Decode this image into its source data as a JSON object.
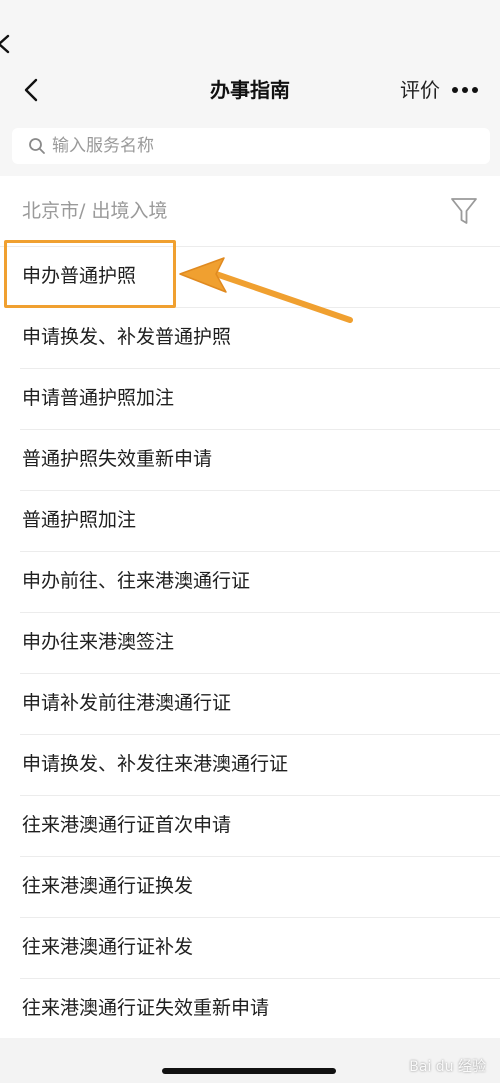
{
  "header": {
    "title": "办事指南",
    "rate_label": "评价"
  },
  "search": {
    "placeholder": "输入服务名称"
  },
  "filter": {
    "breadcrumb": "北京市/ 出境入境"
  },
  "services": [
    "申办普通护照",
    "申请换发、补发普通护照",
    "申请普通护照加注",
    "普通护照失效重新申请",
    "普通护照加注",
    "申办前往、往来港澳通行证",
    "申办往来港澳签注",
    "申请补发前往港澳通行证",
    "申请换发、补发往来港澳通行证",
    "往来港澳通行证首次申请",
    "往来港澳通行证换发",
    "往来港澳通行证补发",
    "往来港澳通行证失效重新申请"
  ],
  "watermark": {
    "text": "Bai du 经验"
  },
  "colors": {
    "highlight": "#f0a030",
    "header_bg": "#f6f6f6"
  },
  "icons": {
    "back": "chevron-left-icon",
    "more": "more-dots-icon",
    "search": "search-icon",
    "filter": "funnel-icon"
  }
}
